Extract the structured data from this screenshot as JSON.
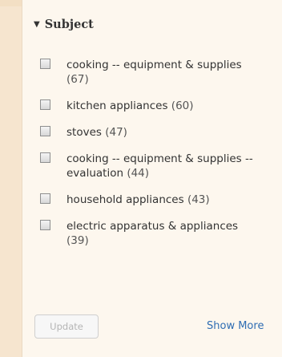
{
  "facet": {
    "title": "Subject",
    "items": [
      {
        "label": "cooking -- equipment & supplies",
        "count": "(67)"
      },
      {
        "label": "kitchen appliances",
        "count": "(60)"
      },
      {
        "label": "stoves",
        "count": "(47)"
      },
      {
        "label": "cooking -- equipment & supplies -- evaluation",
        "count": "(44)"
      },
      {
        "label": "household appliances",
        "count": "(43)"
      },
      {
        "label": "electric apparatus & appliances",
        "count": "(39)"
      }
    ]
  },
  "actions": {
    "update_label": "Update",
    "show_more_label": "Show More"
  },
  "colors": {
    "page_bg": "#f6e5cf",
    "panel_bg": "#fdf7ee",
    "link": "#2f6db3"
  },
  "icons": {
    "header": "triangle-down-icon"
  }
}
